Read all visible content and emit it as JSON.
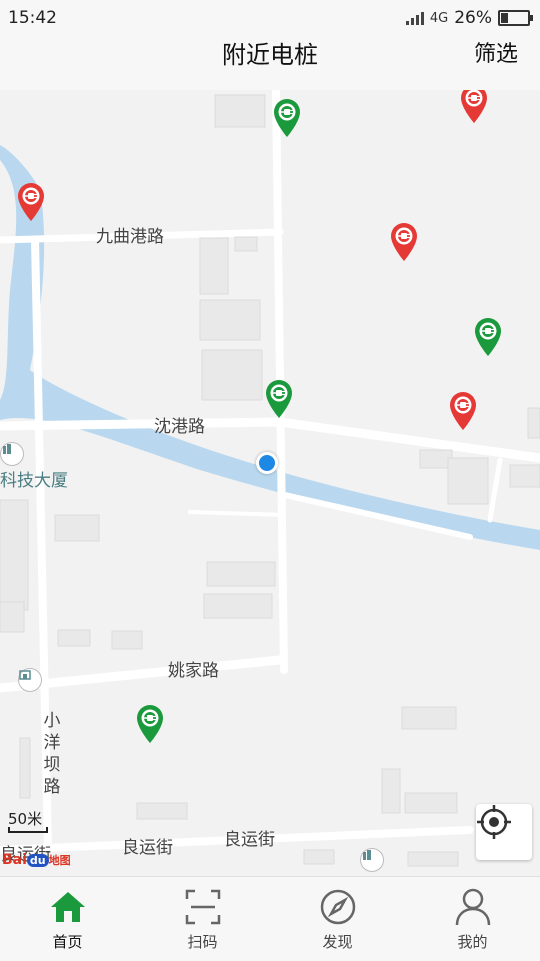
{
  "status_bar": {
    "time": "15:42",
    "network": "4G",
    "battery_text": "26%",
    "battery_level": 0.26
  },
  "header": {
    "title": "附近电桩",
    "filter_label": "筛选"
  },
  "map": {
    "road_labels": {
      "jiuqu": "九曲港路",
      "shengang": "沈港路",
      "yaojia": "姚家路",
      "liangyun1": "良运街",
      "liangyun2": "良运街",
      "liangyun3": "良运街"
    },
    "vertical_label": "小洋坝路",
    "poi_label": "科技大厦",
    "scale_label": "50米",
    "logo": {
      "bai": "Bai",
      "du": "du",
      "ditu": "地图"
    },
    "pin_colors": {
      "available": "#1a9a3c",
      "busy": "#e53935"
    }
  },
  "tabs": [
    {
      "label": "首页",
      "icon": "home-icon",
      "active": true
    },
    {
      "label": "扫码",
      "icon": "scan-icon",
      "active": false
    },
    {
      "label": "发现",
      "icon": "compass-icon",
      "active": false
    },
    {
      "label": "我的",
      "icon": "user-icon",
      "active": false
    }
  ],
  "colors": {
    "accent": "#1a9a3c",
    "water": "#b9d8ef"
  }
}
